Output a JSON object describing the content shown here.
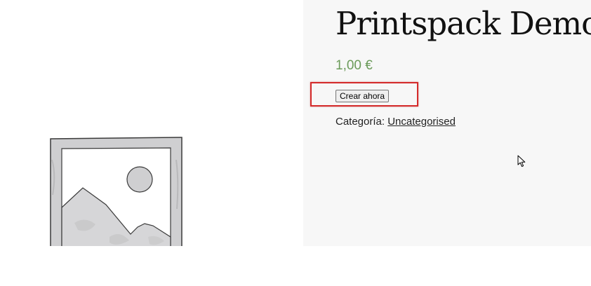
{
  "product": {
    "title": "Printspack Demo",
    "price": "1,00 €",
    "create_button_label": "Crear ahora",
    "category_label": "Categoría:",
    "category_value": "Uncategorised"
  },
  "icons": {
    "product_image": "image-placeholder-icon",
    "cursor": "mouse-pointer-icon"
  },
  "colors": {
    "price": "#6b9b5a",
    "highlight": "#d42a2a",
    "summary_background": "#f7f7f7"
  }
}
